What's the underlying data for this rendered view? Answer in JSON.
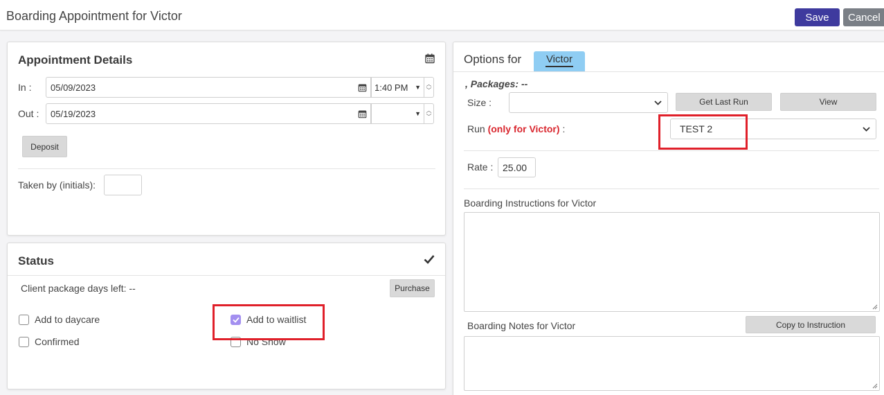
{
  "header": {
    "title": "Boarding Appointment for Victor",
    "save_label": "Save",
    "cancel_label": "Cancel"
  },
  "appointment": {
    "title": "Appointment Details",
    "in_label": "In :",
    "in_date": "05/09/2023",
    "in_time": "1:40 PM",
    "out_label": "Out :",
    "out_date": "05/19/2023",
    "out_time": "",
    "deposit_label": "Deposit",
    "taken_by_label": "Taken by (initials):",
    "taken_by_value": ""
  },
  "status": {
    "title": "Status",
    "package_days_label": "Client package days left: --",
    "purchase_label": "Purchase",
    "checkboxes": {
      "add_to_daycare": {
        "label": "Add to daycare",
        "checked": false
      },
      "confirmed": {
        "label": "Confirmed",
        "checked": false
      },
      "add_to_waitlist": {
        "label": "Add to waitlist",
        "checked": true
      },
      "no_show": {
        "label": "No Show",
        "checked": false
      }
    }
  },
  "options": {
    "title": "Options for",
    "pet_tab": "Victor",
    "packages_label": ", Packages: --",
    "size_label": "Size :",
    "size_value": "",
    "get_last_run_label": "Get Last Run",
    "view_label": "View",
    "run_label_prefix": "Run",
    "run_label_highlight": "(only for Victor)",
    "run_label_suffix": ":",
    "run_value": "TEST 2",
    "rate_label": "Rate :",
    "rate_value": "25.00",
    "instructions_label": "Boarding Instructions for Victor",
    "notes_label": "Boarding Notes for Victor",
    "copy_label": "Copy to Instruction"
  },
  "colors": {
    "save": "#3e3a9e",
    "cancel": "#7a7f86",
    "highlight_text": "#d9262e",
    "annotation_box": "#e0202a",
    "pet_tab": "#8fcdf3",
    "checkbox_checked": "#a38ff0"
  }
}
